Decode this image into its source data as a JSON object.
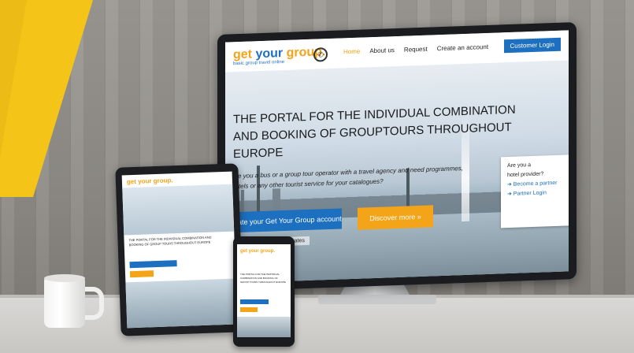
{
  "scene": {
    "description_colors": {
      "accent_orange": "#f4a418",
      "brand_blue": "#1d6fbf",
      "banner_yellow": "#f5c418"
    }
  },
  "website": {
    "logo": {
      "part1": "get ",
      "part2": "your",
      "part3": " group.",
      "subtitle": "basic group travel online"
    },
    "nav": {
      "home": "Home",
      "about": "About us",
      "request": "Request",
      "create_account": "Create an account",
      "login": "Customer Login"
    },
    "headline_line1": "THE PORTAL FOR THE INDIVIDUAL COMBINATION",
    "headline_line2": "AND BOOKING OF GROUPTOURS THROUGHOUT EUROPE",
    "tagline": "Are you a bus or a group tour operator with a travel agency and need programmes, hotels or any other tourist service for your catalogues?",
    "create_button": "reate your Get Your Group account",
    "discover_button": "Discover more",
    "benefit": "Benefit from B-2-B group rates",
    "hotel_box": {
      "line1": "Are you a",
      "line2": "hotel provider?",
      "link1": "➜ Become a partner",
      "link2": "➜ Partner Login"
    }
  },
  "tablet": {
    "logo": "get your group.",
    "text": "THE PORTAL FOR THE INDIVIDUAL COMBINATION AND BOOKING OF GROUP TOURS THROUGHOUT EUROPE"
  },
  "phone": {
    "logo": "get your group.",
    "text": "THE PORTAL FOR THE INDIVIDUAL COMBINATION AND BOOKING OF GROUP TOURS THROUGHOUT EUROPE"
  }
}
